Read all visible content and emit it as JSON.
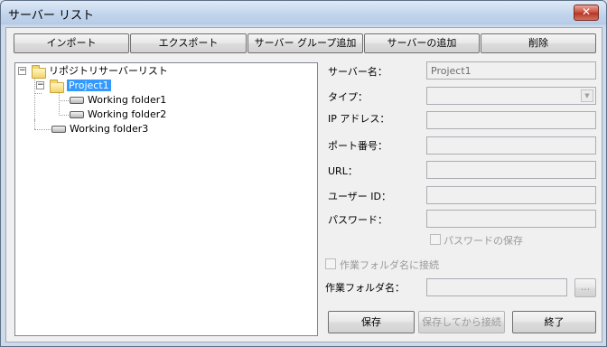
{
  "window": {
    "title": "サーバー リスト",
    "close_glyph": "✕"
  },
  "toolbar": {
    "import_label": "インポート",
    "export_label": "エクスポート",
    "add_group_label": "サーバー グループ追加",
    "add_server_label": "サーバーの追加",
    "delete_label": "削除"
  },
  "tree": {
    "root_label": "リポジトリサーバーリスト",
    "project_label": "Project1",
    "folder1_label": "Working folder1",
    "folder2_label": "Working folder2",
    "folder3_label": "Working folder3",
    "expander_glyph": "−"
  },
  "form": {
    "server_name_label": "サーバー名：",
    "server_name_value": "Project1",
    "type_label": "タイプ：",
    "type_value": "",
    "ip_label": "IP アドレス：",
    "ip_value": "",
    "port_label": "ポート番号：",
    "port_value": "",
    "url_label": "URL：",
    "url_value": "",
    "user_label": "ユーザー ID：",
    "user_value": "",
    "password_label": "パスワード：",
    "password_value": "",
    "save_password_label": "パスワードの保存",
    "connect_workfolder_label": "作業フォルダ名に接続",
    "workfolder_label": "作業フォルダ名：",
    "workfolder_value": "",
    "browse_label": "..."
  },
  "actions": {
    "save_label": "保存",
    "save_connect_label": "保存してから接続",
    "finish_label": "終了"
  },
  "colors": {
    "selection": "#3399ff",
    "title_bar": "#c1d4ec",
    "close": "#c9493a"
  },
  "icons": [
    "close-icon",
    "folder-icon",
    "drive-icon",
    "expander-icon",
    "dropdown-arrow-icon"
  ]
}
